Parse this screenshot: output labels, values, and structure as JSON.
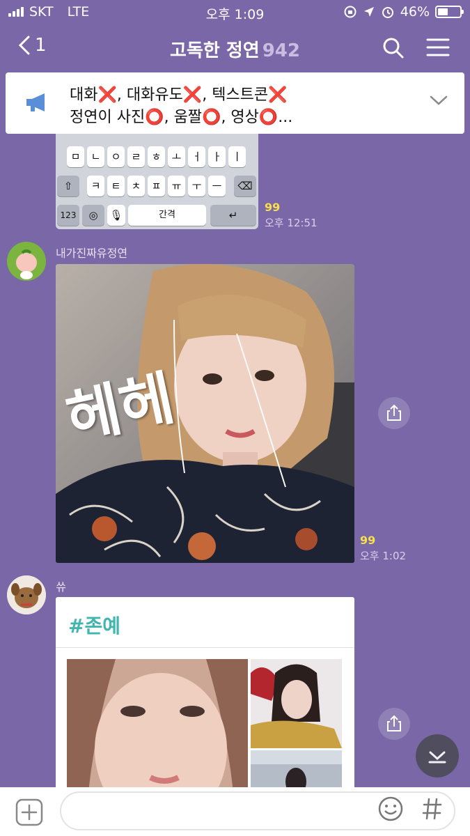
{
  "status": {
    "carrier": "SKT",
    "network": "LTE",
    "time": "오후 1:09",
    "battery": "46%",
    "battery_level": 0.46
  },
  "nav": {
    "back_count": "1",
    "title": "고독한 정연",
    "member_count": "942"
  },
  "notice": {
    "line1": "대화❌, 대화유도❌, 텍스트콘❌",
    "line2": "정연이 사진⭕, 움짤⭕, 영상⭕..."
  },
  "keyboard": {
    "row1": [
      "ㅁ",
      "ㄴ",
      "ㅇ",
      "ㄹ",
      "ㅎ",
      "ㅗ",
      "ㅓ",
      "ㅏ",
      "ㅣ"
    ],
    "row2": [
      "ㅋ",
      "ㅌ",
      "ㅊ",
      "ㅍ",
      "ㅠ",
      "ㅜ",
      "ㅡ"
    ],
    "numbers_key": "123",
    "space_key": "간격"
  },
  "messages": [
    {
      "read_count": "99",
      "time": "오후 12:51"
    },
    {
      "sender": "내가진짜유정연",
      "overlay_text": "헤헤",
      "read_count": "99",
      "time": "오후 1:02"
    },
    {
      "sender": "쓔",
      "card_title": "#존예"
    }
  ],
  "colors": {
    "background": "#7a67a8",
    "read_count": "#f6e04a",
    "card_title": "#41b6ae"
  }
}
